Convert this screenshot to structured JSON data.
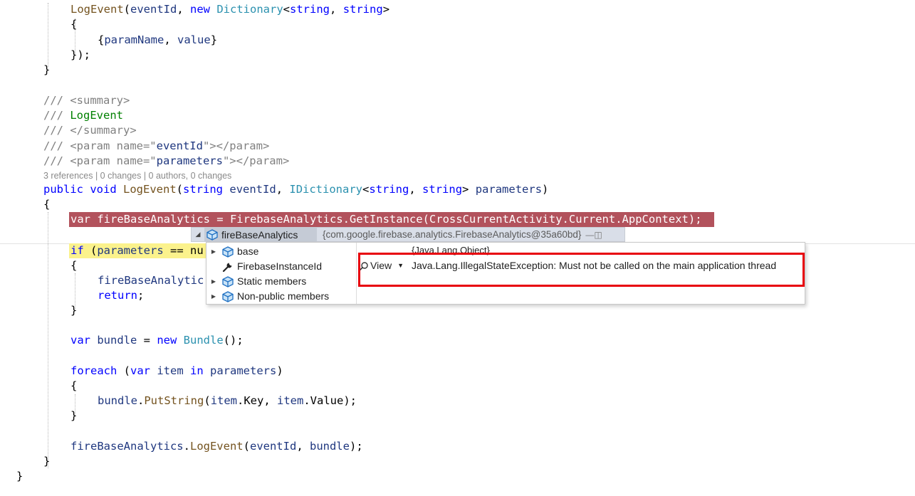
{
  "editor": {
    "lines": {
      "l1_method": "LogEvent",
      "l1_a": "(",
      "l1_param": "eventId",
      "l1_b": ", ",
      "l1_new": "new",
      "l1_dict": "Dictionary",
      "l1_c": "<",
      "l1_string1": "string",
      "l1_d": ", ",
      "l1_string2": "string",
      "l1_e": ">",
      "l2": "{",
      "l3_a": "{",
      "l3_name": "paramName",
      "l3_b": ", ",
      "l3_val": "value",
      "l3_c": "}",
      "l4": "});",
      "l5": "}",
      "c1": "/// <summary>",
      "c2_prefix": "/// ",
      "c2_text": "LogEvent",
      "c3": "/// </summary>",
      "c4_a": "/// <param name=\"",
      "c4_name": "eventId",
      "c4_b": "\"></param>",
      "c5_a": "/// <param name=\"",
      "c5_name": "parameters",
      "c5_b": "\"></param>",
      "codelens": "3 references | 0 changes | 0 authors, 0 changes",
      "sig_public": "public",
      "sig_void": "void",
      "sig_method": "LogEvent",
      "sig_a": "(",
      "sig_string": "string",
      "sig_p1": "eventId",
      "sig_b": ", ",
      "sig_idict": "IDictionary",
      "sig_c": "<",
      "sig_string2": "string",
      "sig_d": ", ",
      "sig_string3": "string",
      "sig_e": "> ",
      "sig_p2": "parameters",
      "sig_f": ")",
      "open": "{",
      "red_line": "var fireBaseAnalytics = FirebaseAnalytics.GetInstance(CrossCurrentActivity.Current.AppContext);",
      "if_kw": "if",
      "if_rest_a": " (",
      "if_param": "parameters",
      "if_rest_b": " == nu",
      "if_open": "{",
      "fb_call": "fireBaseAnalytic",
      "return_kw": "return",
      "return_semi": ";",
      "if_close": "}",
      "var_kw": "var",
      "bundle_var": " bundle",
      "bundle_eq": " = ",
      "new_kw": "new",
      "bundle_type": "Bundle",
      "bundle_end": "();",
      "foreach_kw": "foreach",
      "fe_a": " (",
      "fe_var": "var",
      "fe_item": " item ",
      "fe_in": "in",
      "fe_params": " parameters",
      "fe_b": ")",
      "fe_open": "{",
      "put_bundle": "bundle",
      "put_dot": ".",
      "put_method": "PutString",
      "put_a": "(",
      "put_item1": "item",
      "put_key": ".Key, ",
      "put_item2": "item",
      "put_value": ".Value);",
      "fe_close": "}",
      "log_var": "fireBaseAnalytics",
      "log_dot": ".",
      "log_method": "LogEvent",
      "log_a": "(",
      "log_p1": "eventId",
      "log_b": ", ",
      "log_p2": "bundle",
      "log_c": ");",
      "method_close": "}",
      "class_close": "}"
    }
  },
  "datatip": {
    "name": "fireBaseAnalytics",
    "value": "{com.google.firebase.analytics.FirebaseAnalytics@35a60bd}",
    "members": [
      {
        "label": "base",
        "value": "{Java.Lang.Object}"
      },
      {
        "label": "FirebaseInstanceId",
        "value": "Java.Lang.IllegalStateException: Must not be called on the main application thread"
      },
      {
        "label": "Static members"
      },
      {
        "label": "Non-public members"
      }
    ],
    "view_label": "View"
  },
  "colors": {
    "keyword": "#0000ff",
    "type": "#2b91af",
    "comment": "#808080",
    "error_highlight": "#b2525c",
    "current_statement": "#fbf28c",
    "callout_border": "#e8000b"
  }
}
